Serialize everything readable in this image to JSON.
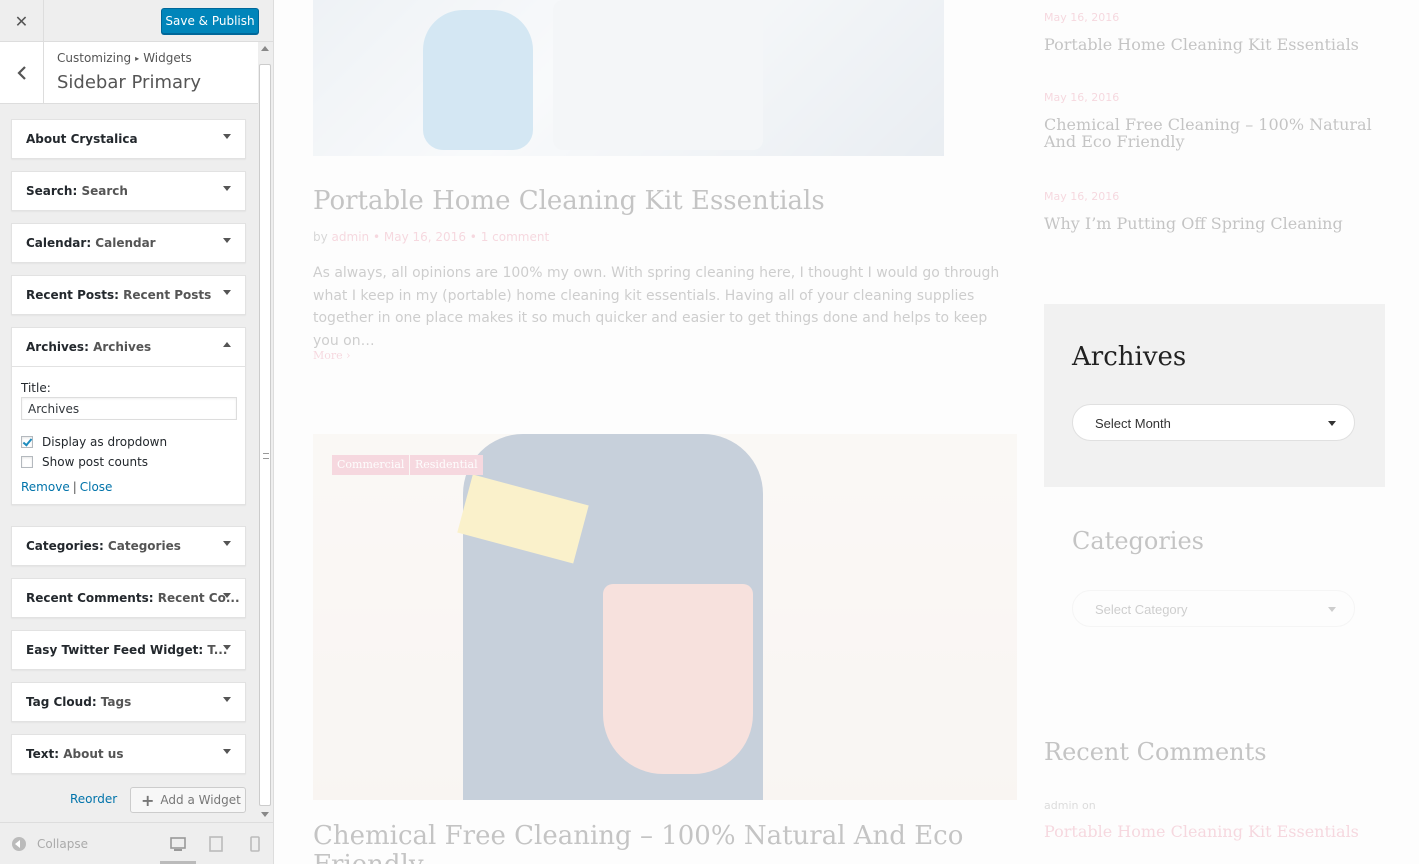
{
  "customizer": {
    "close_icon": "close-icon",
    "save_label": "Save & Publish",
    "breadcrumb_root": "Customizing",
    "breadcrumb_sep": "▸",
    "breadcrumb_leaf": "Widgets",
    "section_title": "Sidebar Primary",
    "widgets": [
      {
        "name": "About Crystalica",
        "subtitle": ""
      },
      {
        "name": "Search",
        "subtitle": "Search"
      },
      {
        "name": "Calendar",
        "subtitle": "Calendar"
      },
      {
        "name": "Recent Posts",
        "subtitle": "Recent Posts"
      },
      {
        "name": "Archives",
        "subtitle": "Archives"
      },
      {
        "name": "Categories",
        "subtitle": "Categories"
      },
      {
        "name": "Recent Comments",
        "subtitle": "Recent Co..."
      },
      {
        "name": "Easy Twitter Feed Widget",
        "subtitle": "T..."
      },
      {
        "name": "Tag Cloud",
        "subtitle": "Tags"
      },
      {
        "name": "Text",
        "subtitle": "About us"
      }
    ],
    "archives_form": {
      "title_label": "Title:",
      "title_value": "Archives",
      "dropdown_label": "Display as dropdown",
      "dropdown_checked": true,
      "counts_label": "Show post counts",
      "counts_checked": false,
      "remove_label": "Remove",
      "close_label": "Close"
    },
    "reorder_label": "Reorder",
    "add_widget_label": "Add a Widget",
    "collapse_label": "Collapse"
  },
  "preview": {
    "post1": {
      "title": "Portable Home Cleaning Kit Essentials",
      "by": "by",
      "author": "admin",
      "date": "May 16, 2016",
      "comments": "1 comment",
      "excerpt": "As always, all opinions are 100% my own. With spring cleaning here, I thought I would go through what I keep in my (portable) home cleaning kit essentials. Having all of your cleaning supplies together in one place makes it so much quicker and easier to get things done and helps to keep you on…",
      "more": "More"
    },
    "post2": {
      "tags": [
        "Commercial",
        "Residential"
      ],
      "title_line1": "Chemical Free Cleaning – 100% Natural And Eco",
      "title_line2": "Friendly"
    },
    "recent_posts": [
      {
        "date": "May 16, 2016",
        "title": "Portable Home Cleaning Kit Essentials"
      },
      {
        "date": "May 16, 2016",
        "title": "Chemical Free Cleaning – 100% Natural And Eco Friendly"
      },
      {
        "date": "May 16, 2016",
        "title": "Why I’m Putting Off Spring Cleaning"
      }
    ],
    "archives": {
      "title": "Archives",
      "select": "Select Month"
    },
    "categories": {
      "title": "Categories",
      "select": "Select Category"
    },
    "recent_comments": {
      "title": "Recent Comments",
      "meta": "admin on",
      "link": "Portable Home Cleaning Kit Essentials"
    }
  }
}
